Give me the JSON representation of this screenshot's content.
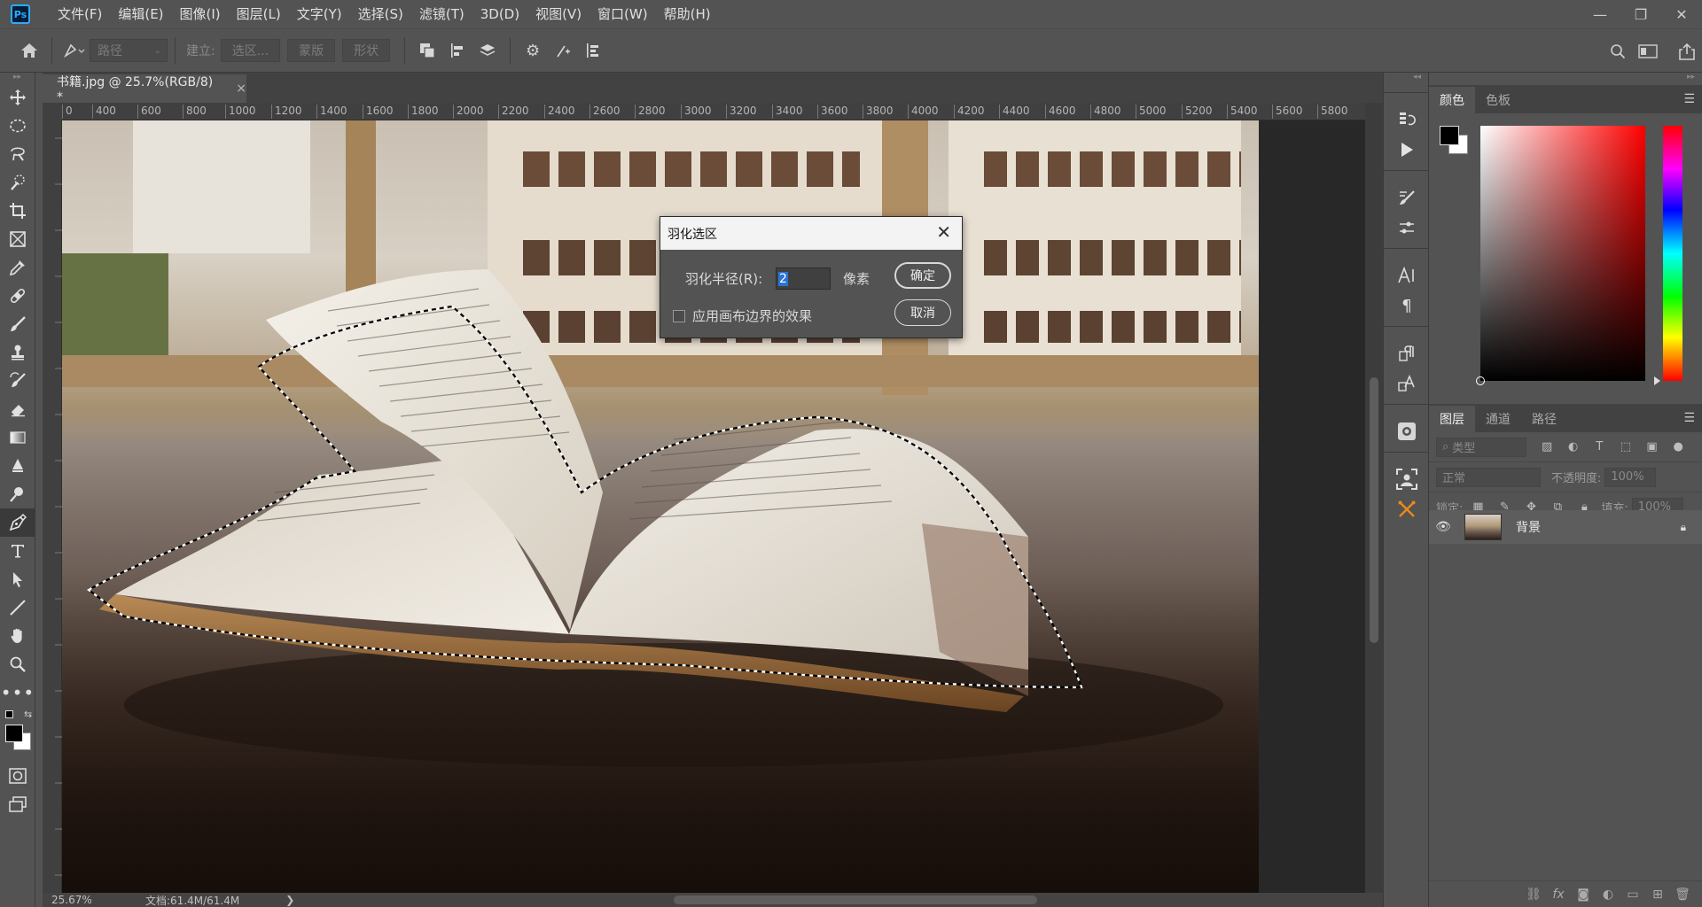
{
  "app": {
    "logo": "Ps"
  },
  "menu": [
    "文件(F)",
    "编辑(E)",
    "图像(I)",
    "图层(L)",
    "文字(Y)",
    "选择(S)",
    "滤镜(T)",
    "3D(D)",
    "视图(V)",
    "窗口(W)",
    "帮助(H)"
  ],
  "window_controls": {
    "minimize": "—",
    "restore": "❐",
    "close": "✕"
  },
  "options": {
    "mode_select": "路径",
    "make_label": "建立:",
    "selection_button": "选区...",
    "mask_button": "蒙版",
    "shape_button": "形状"
  },
  "document": {
    "tab_title": "书籍.jpg @ 25.7%(RGB/8) *",
    "tab_close": "×",
    "ruler_ticks": [
      "0",
      "400",
      "600",
      "800",
      "1000",
      "1200",
      "1400",
      "1600",
      "1800",
      "2000",
      "2200",
      "2400",
      "2600",
      "2800",
      "3000",
      "3200",
      "3400",
      "3600",
      "3800",
      "4000",
      "4200",
      "4400",
      "4600",
      "4800",
      "5000",
      "5200",
      "5400",
      "5600",
      "5800"
    ]
  },
  "status": {
    "zoom": "25.67%",
    "doc_size": "文档:61.4M/61.4M",
    "arrow": "❯"
  },
  "dialog": {
    "title": "羽化选区",
    "radius_label": "羽化半径(R):",
    "radius_value": "2",
    "unit": "像素",
    "checkbox_label": "应用画布边界的效果",
    "checkbox_checked": false,
    "ok": "确定",
    "cancel": "取消"
  },
  "color_panel": {
    "tabs": [
      "颜色",
      "色板"
    ],
    "foreground": "#000000",
    "background": "#ffffff"
  },
  "layers_panel": {
    "tabs": [
      "图层",
      "通道",
      "路径"
    ],
    "filter_placeholder": "类型",
    "blend_mode": "正常",
    "opacity_label": "不透明度:",
    "opacity_value": "100%",
    "lock_label": "锁定:",
    "fill_label": "填充:",
    "fill_value": "100%",
    "layers": [
      {
        "name": "背景",
        "visible": true,
        "locked": true
      }
    ]
  }
}
